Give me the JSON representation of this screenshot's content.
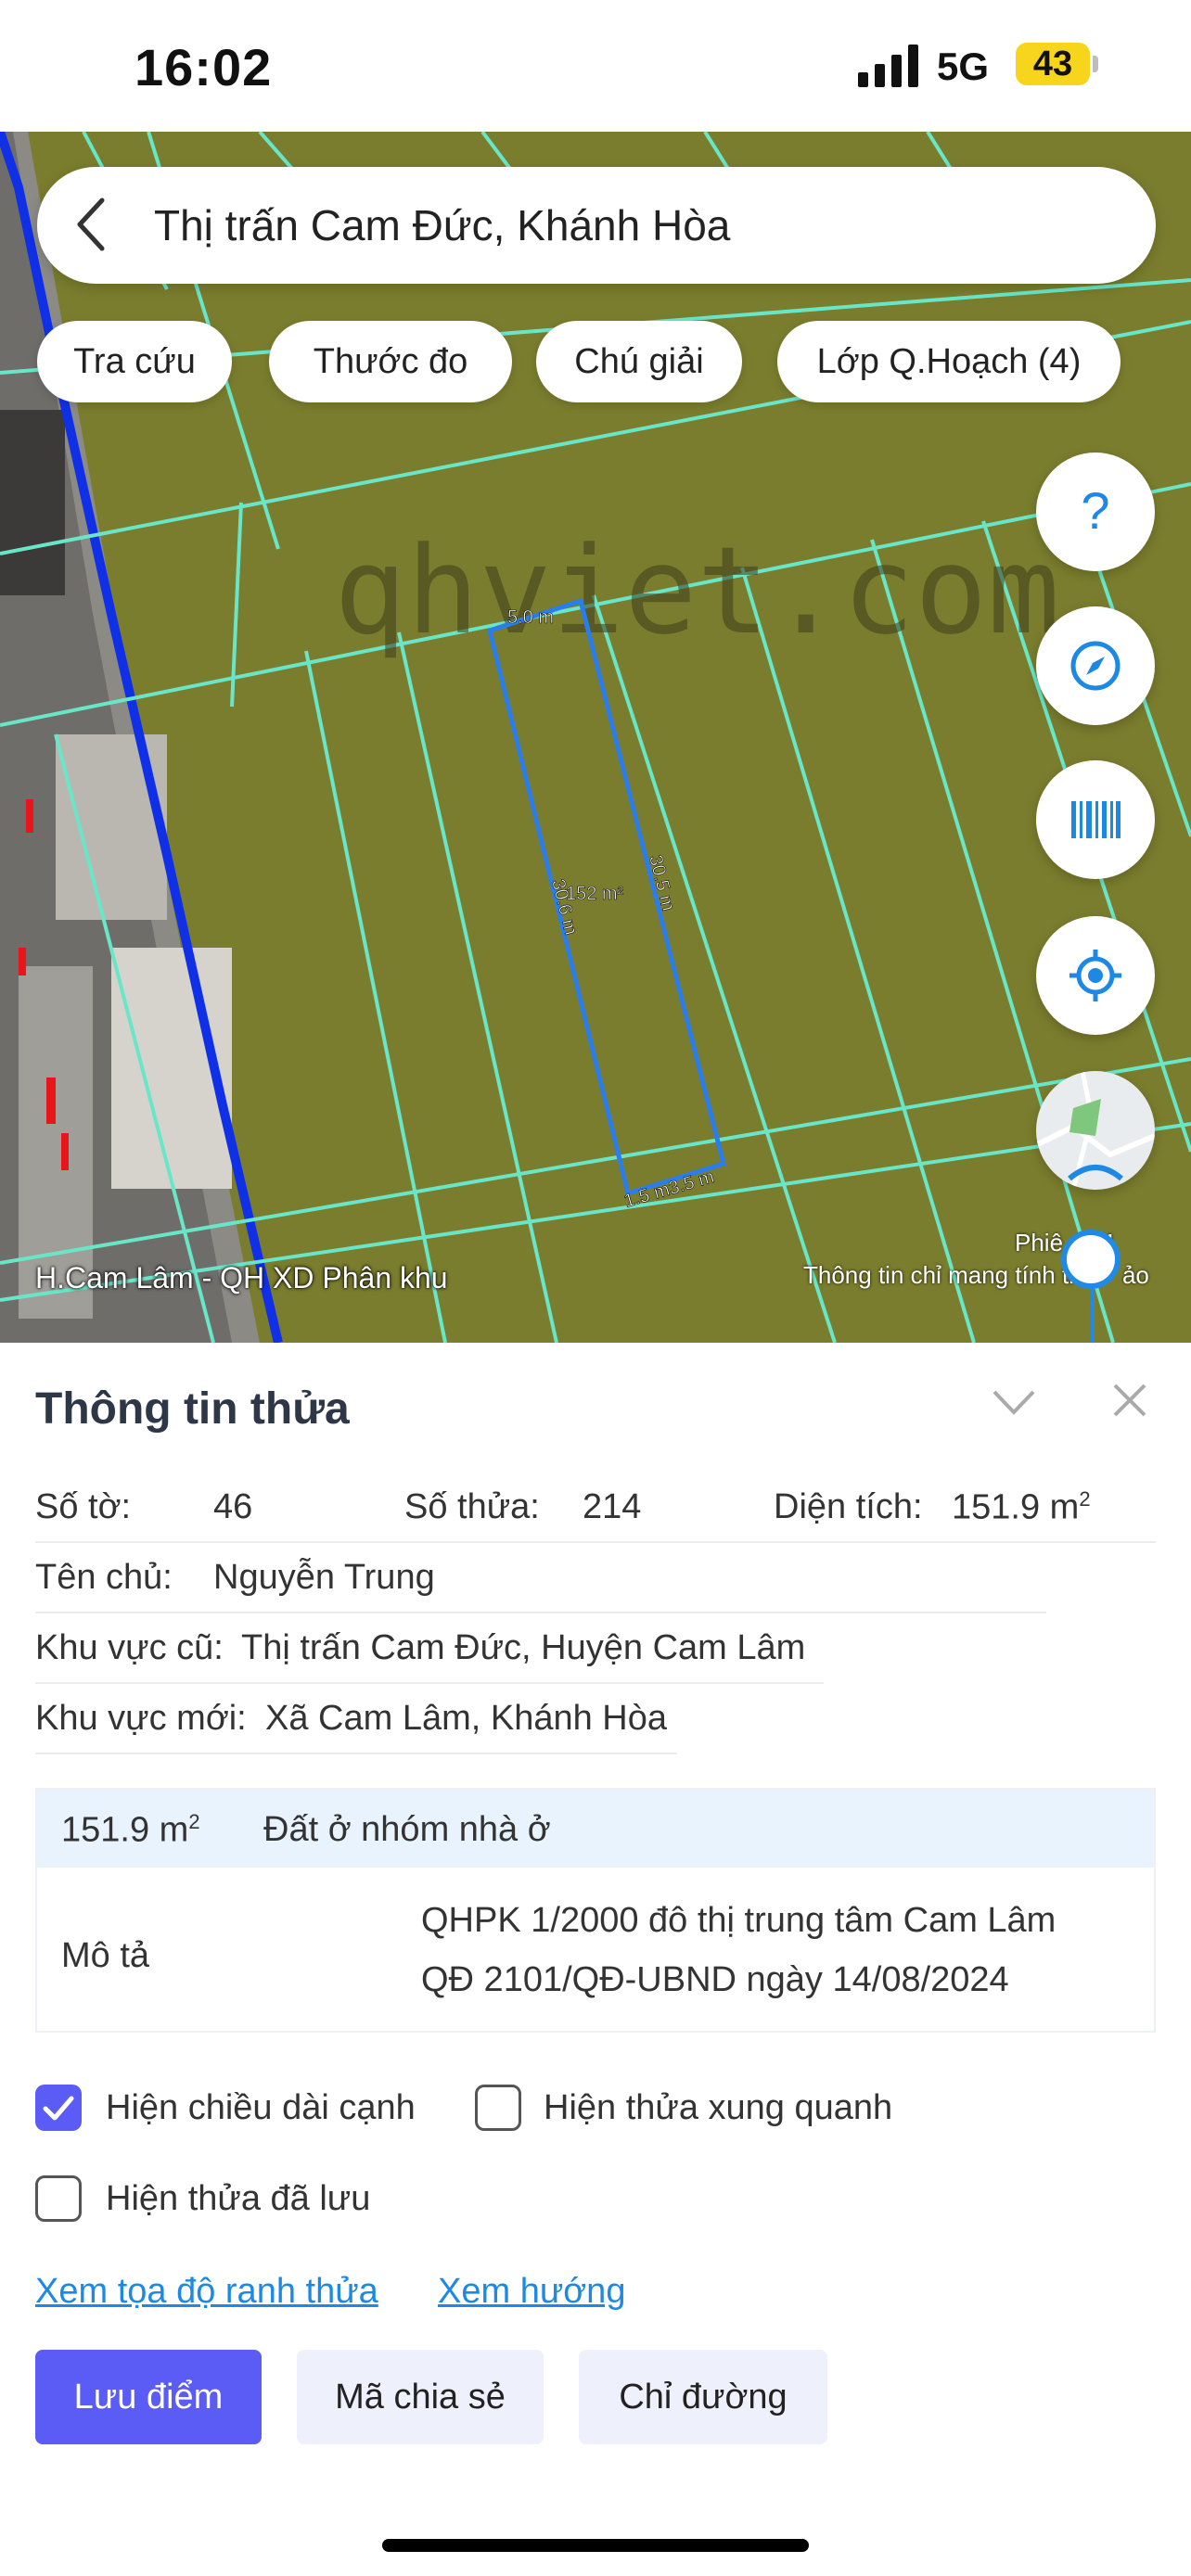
{
  "status_bar": {
    "time": "16:02",
    "network": "5G",
    "battery": "43"
  },
  "search": {
    "back_icon": "chevron-left-icon",
    "text": "Thị trấn Cam Đức, Khánh Hòa"
  },
  "chips": [
    {
      "label": "Tra cứu"
    },
    {
      "label": "Thước đo"
    },
    {
      "label": "Chú giải"
    },
    {
      "label": "Lớp Q.Hoạch (4)"
    }
  ],
  "map": {
    "watermark": "qhviet.com",
    "parcel": {
      "top_edge": "5.0 m",
      "left_edge": "30.6 m",
      "right_edge": "30.5 m",
      "area": "152 m²",
      "bottom_edge": "1.5 m3.5 m"
    },
    "layer_label": "H.Cam Lâm - QH XD Phân khu",
    "version": "Phiê",
    "version_tail": "4.1",
    "note": "Thông tin chỉ mang tính th",
    "note_tail": "ảo",
    "fab_icons": [
      "help-icon",
      "compass-icon",
      "barcode-icon",
      "locate-icon"
    ]
  },
  "panel": {
    "title": "Thông tin thửa",
    "so_to_label": "Số tờ:",
    "so_to_value": "46",
    "so_thua_label": "Số thửa:",
    "so_thua_value": "214",
    "dien_tich_label": "Diện tích:",
    "dien_tich_value": "151.9 m",
    "dien_tich_sup": "2",
    "ten_chu_label": "Tên chủ:",
    "ten_chu_value": "Nguyễn Trung",
    "khu_vuc_cu_label": "Khu vực cũ:",
    "khu_vuc_cu_value": "Thị trấn Cam Đức, Huyện Cam Lâm",
    "khu_vuc_moi_label": "Khu vực mới:",
    "khu_vuc_moi_value": "Xã Cam Lâm, Khánh Hòa"
  },
  "info_box": {
    "area": "151.9 m",
    "area_sup": "2",
    "land_type": "Đất ở nhóm nhà ở",
    "desc_label": "Mô tả",
    "desc_line1": "QHPK 1/2000 đô thị trung tâm Cam Lâm",
    "desc_line2": "QĐ 2101/QĐ-UBND ngày 14/08/2024"
  },
  "options": {
    "show_edge_length": {
      "label": "Hiện chiều dài cạnh",
      "checked": true
    },
    "show_surrounding": {
      "label": "Hiện thửa xung quanh",
      "checked": false
    },
    "show_saved": {
      "label": "Hiện thửa đã lưu",
      "checked": false
    }
  },
  "links": {
    "coords": "Xem tọa độ ranh thửa",
    "direction": "Xem hướng"
  },
  "buttons": {
    "save": "Lưu điểm",
    "share": "Mã chia sẻ",
    "route": "Chỉ đường"
  },
  "colors": {
    "accent": "#5b5bf5",
    "link": "#1e88e5",
    "map_bg": "#7a7d2d",
    "plot_lines": "#69e6c8",
    "parcel": "#2b7de9"
  }
}
